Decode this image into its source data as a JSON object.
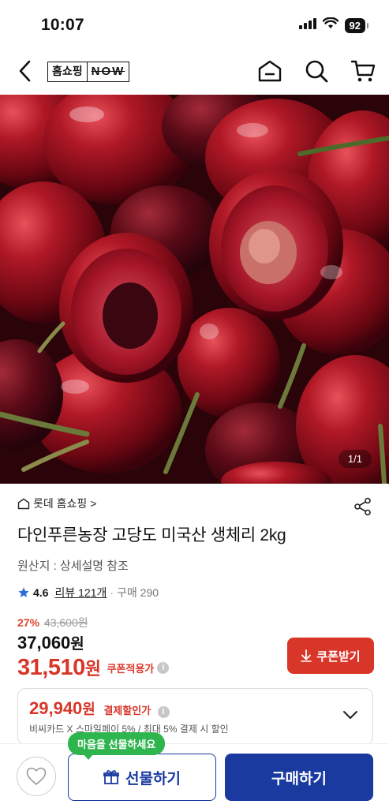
{
  "status": {
    "time": "10:07",
    "battery": "92"
  },
  "header": {
    "logo_kr": "홈쇼핑",
    "logo_now": "NOW"
  },
  "hero": {
    "counter": "1/1"
  },
  "product": {
    "brand": "롯데 홈쇼핑",
    "brand_arrow": ">",
    "title": "다인푸른농장 고당도 미국산 생체리 2kg",
    "origin": "원산지 : 상세설명 참조",
    "rating": "4.6",
    "reviews": "리뷰 121개",
    "purchases": "구매 290",
    "discount_pct": "27%",
    "original_price": "43,600원",
    "sale_price_num": "37,060",
    "sale_price_won": "원",
    "coupon_price_num": "31,510",
    "coupon_price_won": "원",
    "coupon_label": "쿠폰적용가",
    "coupon_btn": "쿠폰받기"
  },
  "payment": {
    "price_num": "29,940",
    "price_won": "원",
    "label": "결제할인가",
    "sub": "비씨카드 X 스마일페이 5% / 최대 5% 결제 시 할인"
  },
  "bottom": {
    "gift_tooltip": "마음을 선물하세요",
    "gift_btn": "선물하기",
    "buy_btn": "구매하기"
  },
  "colors": {
    "accent_red": "#d9362a",
    "brand_blue": "#1a3aa0",
    "tooltip_green": "#2fb54e",
    "star_blue": "#2b6fd6"
  },
  "icons": [
    "back-icon",
    "home-icon",
    "search-icon",
    "cart-icon",
    "share-icon",
    "star-icon",
    "download-icon",
    "chevron-down-icon",
    "heart-icon",
    "gift-icon",
    "signal-icon",
    "wifi-icon",
    "battery-icon"
  ]
}
